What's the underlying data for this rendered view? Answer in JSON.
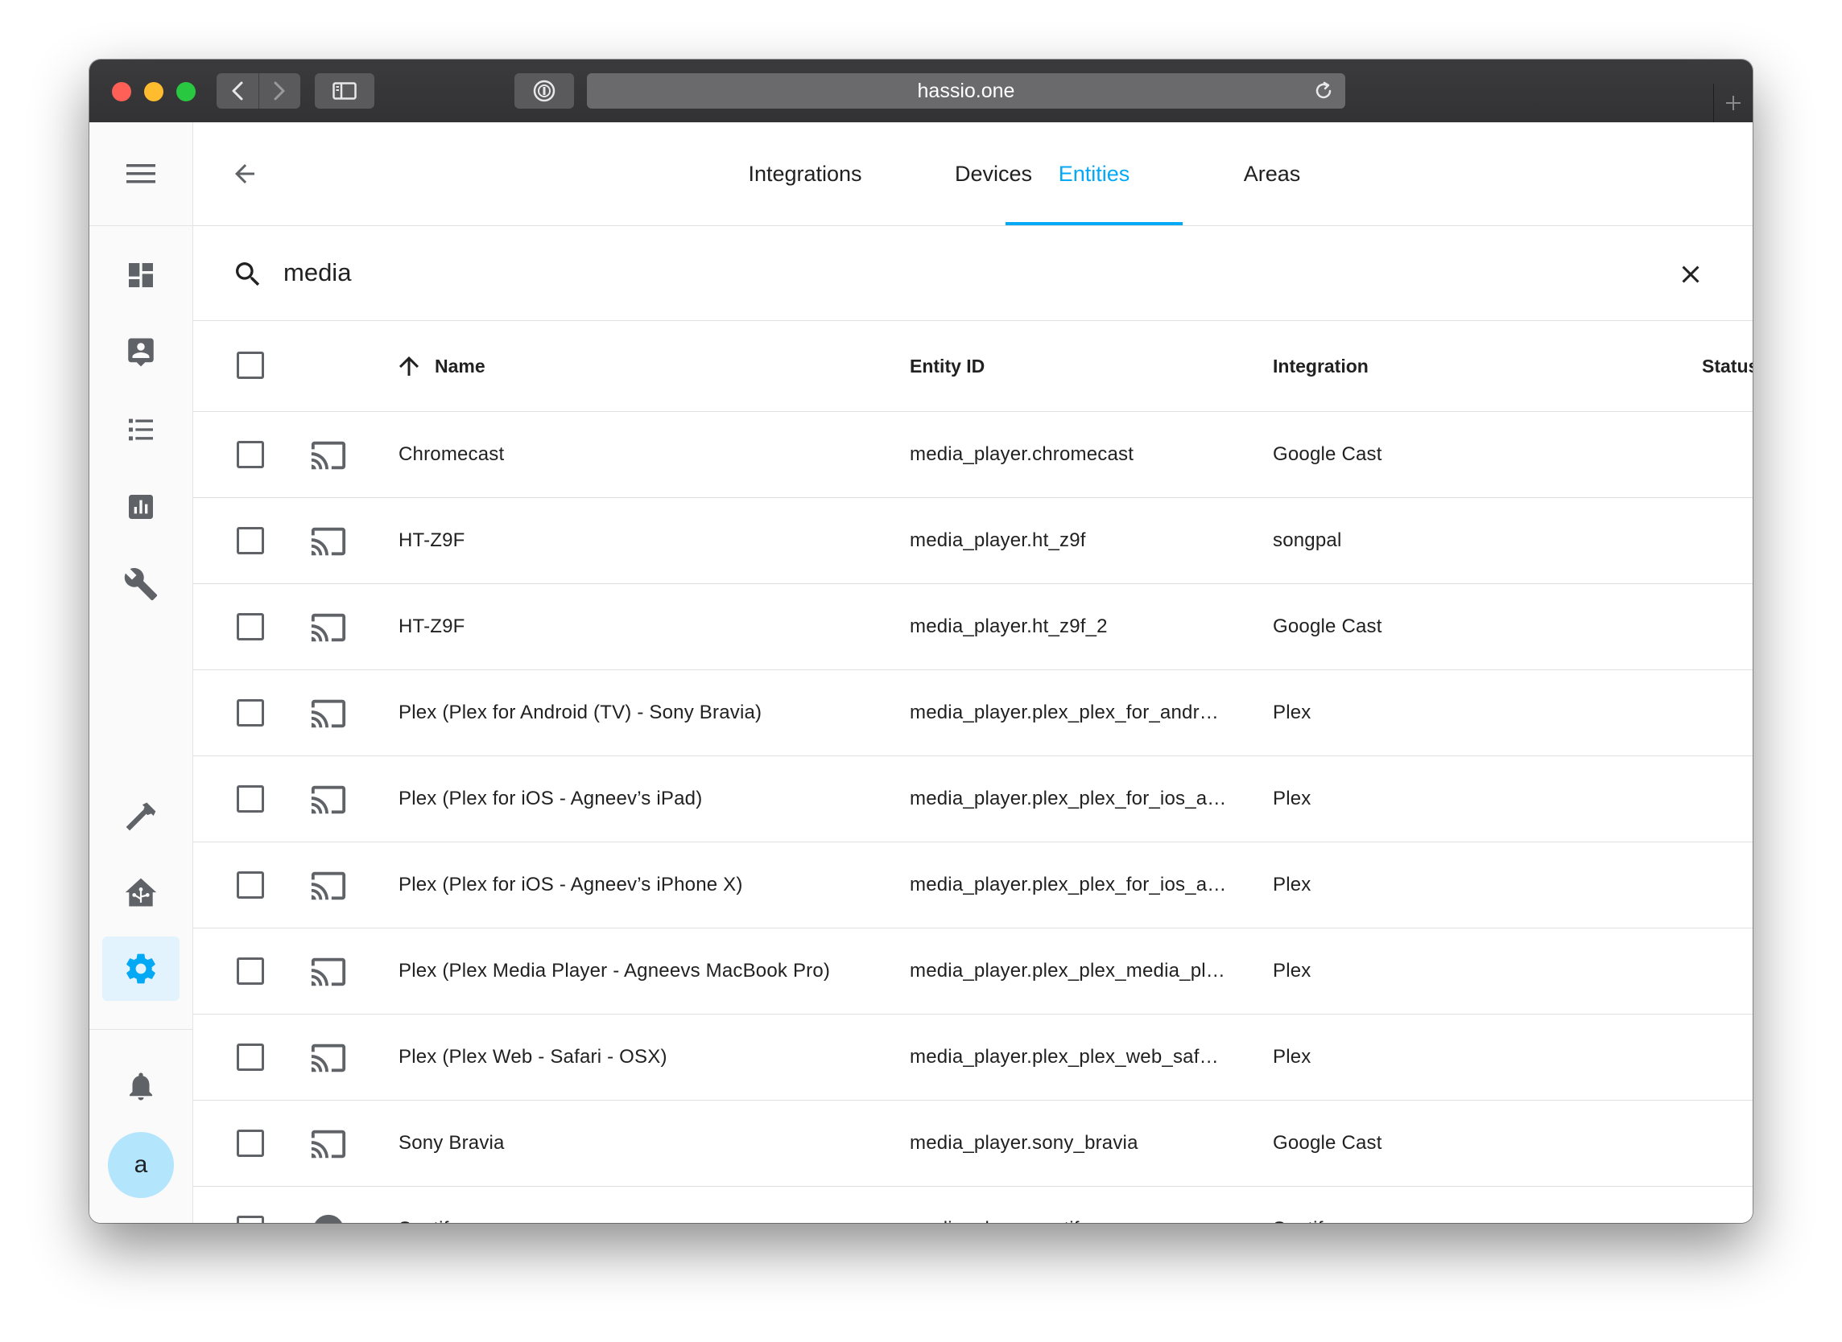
{
  "browser": {
    "url": "hassio.one"
  },
  "sidebar": {
    "items": [
      {
        "icon": "dashboard-icon",
        "label": "Overview"
      },
      {
        "icon": "account-box-icon",
        "label": "Map"
      },
      {
        "icon": "logbook-list-icon",
        "label": "Logbook"
      },
      {
        "icon": "history-chart-icon",
        "label": "History"
      },
      {
        "icon": "wrench-icon",
        "label": "Supervisor"
      },
      {
        "icon": "hammer-icon",
        "label": "Developer Tools"
      },
      {
        "icon": "home-assistant-icon",
        "label": "Home Assistant"
      },
      {
        "icon": "settings-cog-icon",
        "label": "Configuration",
        "active": true
      },
      {
        "icon": "bell-icon",
        "label": "Notifications"
      }
    ],
    "user_initial": "a"
  },
  "tabs": [
    {
      "label": "Integrations",
      "active": false
    },
    {
      "label": "Devices",
      "active": false
    },
    {
      "label": "Entities",
      "active": true
    },
    {
      "label": "Areas",
      "active": false
    }
  ],
  "search": {
    "value": "media",
    "placeholder": "Search"
  },
  "table": {
    "columns": {
      "name": "Name",
      "entity_id": "Entity ID",
      "integration": "Integration",
      "status": "Status"
    },
    "sort": {
      "column": "name",
      "direction": "ascending"
    },
    "rows": [
      {
        "icon": "cast-icon",
        "name": "Chromecast",
        "entity_id": "media_player.chromecast",
        "integration": "Google Cast",
        "status": ""
      },
      {
        "icon": "cast-icon",
        "name": "HT-Z9F",
        "entity_id": "media_player.ht_z9f",
        "integration": "songpal",
        "status": ""
      },
      {
        "icon": "cast-icon",
        "name": "HT-Z9F",
        "entity_id": "media_player.ht_z9f_2",
        "integration": "Google Cast",
        "status": ""
      },
      {
        "icon": "cast-icon",
        "name": "Plex (Plex for Android (TV) - Sony Bravia)",
        "entity_id": "media_player.plex_plex_for_andr…",
        "integration": "Plex",
        "status": "restore-alert-icon"
      },
      {
        "icon": "cast-icon",
        "name": "Plex (Plex for iOS - Agneev’s iPad)",
        "entity_id": "media_player.plex_plex_for_ios_a…",
        "integration": "Plex",
        "status": "restore-alert-icon"
      },
      {
        "icon": "cast-icon",
        "name": "Plex (Plex for iOS - Agneev’s iPhone X)",
        "entity_id": "media_player.plex_plex_for_ios_a…",
        "integration": "Plex",
        "status": "restore-alert-icon"
      },
      {
        "icon": "cast-icon",
        "name": "Plex (Plex Media Player - Agneevs MacBook Pro)",
        "entity_id": "media_player.plex_plex_media_pl…",
        "integration": "Plex",
        "status": "restore-alert-icon"
      },
      {
        "icon": "cast-icon",
        "name": "Plex (Plex Web - Safari - OSX)",
        "entity_id": "media_player.plex_plex_web_saf…",
        "integration": "Plex",
        "status": "restore-alert-icon"
      },
      {
        "icon": "cast-icon",
        "name": "Sony Bravia",
        "entity_id": "media_player.sony_bravia",
        "integration": "Google Cast",
        "status": ""
      },
      {
        "icon": "spotify-icon",
        "name": "Spotify",
        "entity_id": "media_player.spotify_agneev",
        "integration": "Spotify",
        "status": ""
      }
    ]
  },
  "colors": {
    "accent": "#03a9f4",
    "status_alert": "#db4437",
    "icon_gray": "#5f6368"
  }
}
